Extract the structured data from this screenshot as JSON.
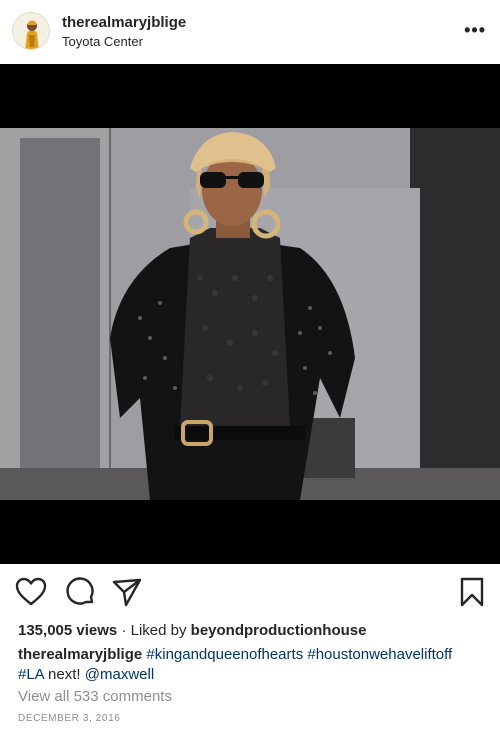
{
  "post": {
    "username": "therealmaryjblige",
    "location": "Toyota Center",
    "more_icon": "more-horizontal-icon"
  },
  "actions": {
    "like_icon": "heart-icon",
    "comment_icon": "comment-icon",
    "share_icon": "paper-plane-icon",
    "save_icon": "bookmark-icon"
  },
  "stats": {
    "views": "135,005 views",
    "separator": "·",
    "liked_by_prefix": "Liked by",
    "liked_by_user": "beyondproductionhouse"
  },
  "caption": {
    "username": "therealmaryjblige",
    "tag1": "#kingandqueenofhearts",
    "tag2": "#houstonwehaveliftoff",
    "tag3": "#LA",
    "text": "next!",
    "mention": "@maxwell"
  },
  "comments_link": "View all 533 comments",
  "date": "DECEMBER 3, 2016",
  "colors": {
    "link": "#003569",
    "muted": "#8e8e8e",
    "text": "#262626"
  }
}
